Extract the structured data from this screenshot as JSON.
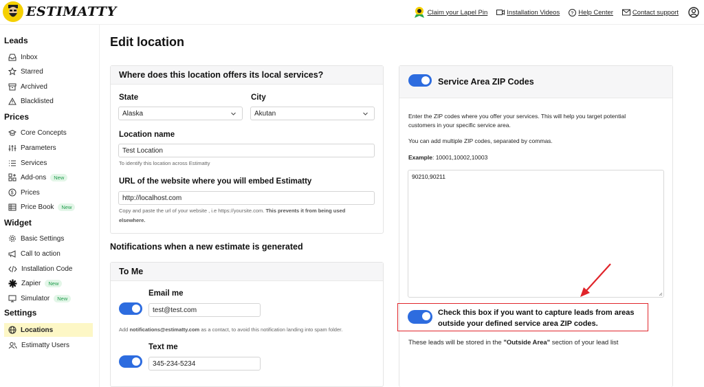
{
  "brand": {
    "name": "ESTIMATTY"
  },
  "topnav": {
    "claim": "Claim your Lapel Pin",
    "videos": "Installation Videos",
    "help": "Help Center",
    "contact": "Contact support"
  },
  "sidebar": {
    "sections": {
      "leads": "Leads",
      "prices": "Prices",
      "widget": "Widget",
      "settings": "Settings"
    },
    "items": {
      "inbox": "Inbox",
      "starred": "Starred",
      "archived": "Archived",
      "blacklisted": "Blacklisted",
      "core": "Core Concepts",
      "params": "Parameters",
      "services": "Services",
      "addons": "Add-ons",
      "prices": "Prices",
      "pricebook": "Price Book",
      "basic": "Basic Settings",
      "cta": "Call to action",
      "install": "Installation Code",
      "zapier": "Zapier",
      "simulator": "Simulator",
      "locations": "Locations",
      "users": "Estimatty Users"
    },
    "new_badge": "New"
  },
  "page": {
    "title": "Edit location"
  },
  "location_card": {
    "header": "Where does this location offers its local services?",
    "state_label": "State",
    "state_value": "Alaska",
    "city_label": "City",
    "city_value": "Akutan",
    "name_label": "Location name",
    "name_value": "Test Location",
    "name_hint": "To identify this location across Estimatty",
    "url_label": "URL of the website where you will embed Estimatty",
    "url_value": "http://localhost.com",
    "url_hint_1": "Copy and paste the url of your website , i.e https://yoursite.com.",
    "url_hint_bold_1": "This prevents it from being used",
    "url_hint_bold_2": "elsewhere."
  },
  "notifications": {
    "title": "Notifications when a new estimate is generated",
    "card_header": "To Me",
    "email_label": "Email me",
    "email_value": "test@test.com",
    "email_hint_pre": "Add",
    "email_hint_bold": "notifications@estimatty.com",
    "email_hint_post": "as a contact, to avoid this notification landing into spam folder.",
    "text_label": "Text me",
    "text_value": "345-234-5234"
  },
  "zip_card": {
    "header": "Service Area ZIP Codes",
    "desc_1": "Enter the ZIP codes where you offer your services. This will help you target potential",
    "desc_2": "customers in your specific service area.",
    "desc_3": "You can add multiple ZIP codes, separated by commas.",
    "example_label": "Example",
    "example_value": ": 10001,10002,10003",
    "zip_value": "90210,90211",
    "outside_1": "Check this box if you want to capture leads from areas",
    "outside_2": "outside your defined service area ZIP codes.",
    "store_pre": "These leads will be stored in the",
    "store_bold": "\"Outside Area\"",
    "store_post": "section of your lead list"
  },
  "colors": {
    "accent": "#2d6cdf",
    "highlight": "#fdf7c6",
    "annotation": "#e0242a",
    "badge_green": "#1d9b4a"
  }
}
